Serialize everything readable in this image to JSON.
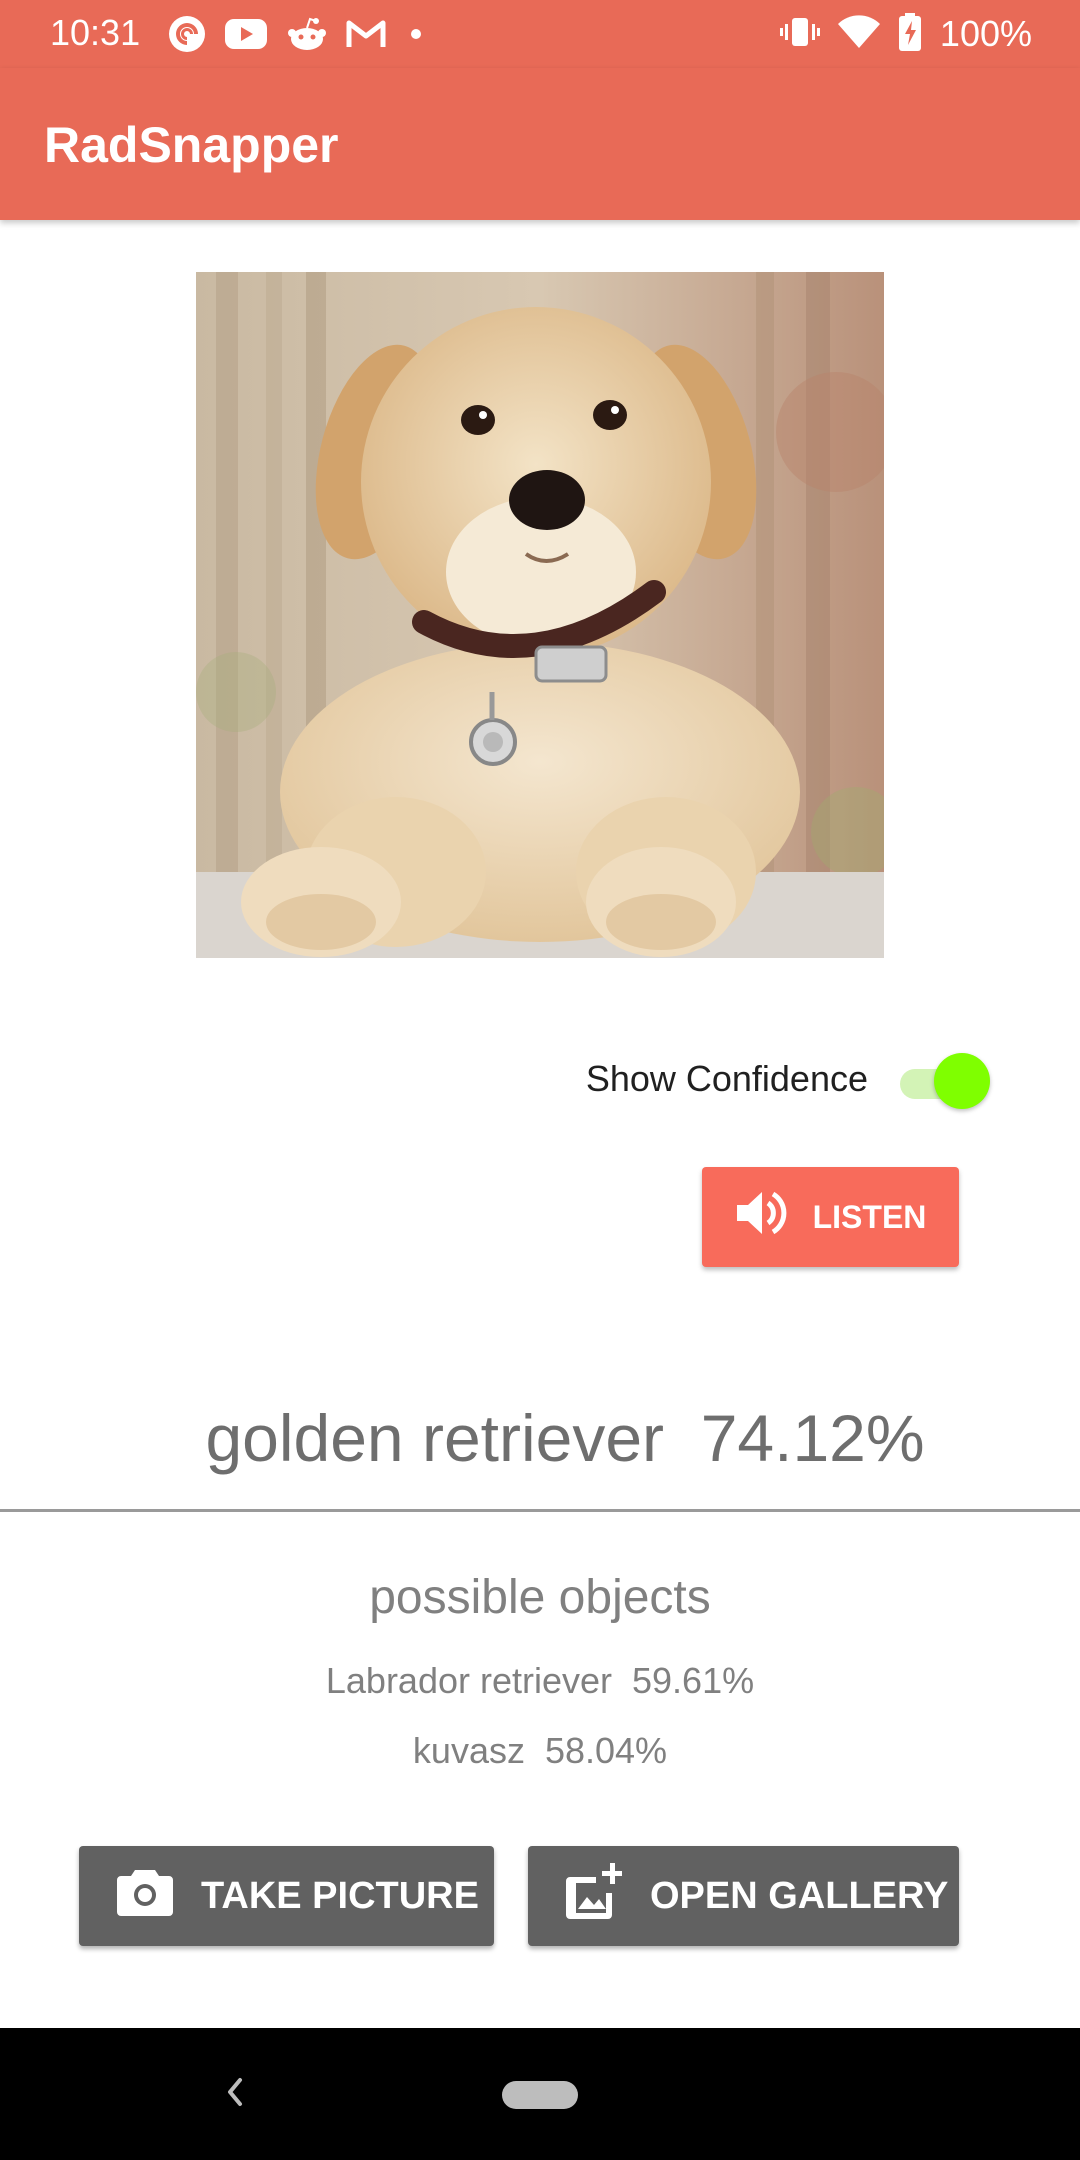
{
  "status_bar": {
    "time": "10:31",
    "notification_icons": [
      "pocket-casts-icon",
      "youtube-icon",
      "reddit-icon",
      "gmail-icon",
      "more-notifications-dot-icon"
    ],
    "system_icons": [
      "vibrate-icon",
      "wifi-icon",
      "battery-charging-icon"
    ],
    "battery": "100%",
    "background_color": "#E86A57"
  },
  "app_bar": {
    "title": "RadSnapper",
    "background_color": "#E86A57"
  },
  "image": {
    "subject": "golden retriever puppy"
  },
  "confidence_toggle": {
    "label": "Show Confidence",
    "checked": true,
    "thumb_color": "#7FFF00"
  },
  "listen_button": {
    "label": "LISTEN",
    "icon": "volume-up-icon",
    "color": "#F86B5B"
  },
  "result": {
    "top_label": "golden retriever  74.12%"
  },
  "possible": {
    "title": "possible objects",
    "items": [
      "Labrador retriever  59.61%",
      "kuvasz  58.04%"
    ]
  },
  "actions": {
    "take_picture": "TAKE PICTURE",
    "take_picture_icon": "camera-icon",
    "open_gallery": "OPEN GALLERY",
    "open_gallery_icon": "add-photo-icon",
    "color": "#616161"
  },
  "nav_bar": {
    "icons": [
      "back-icon",
      "home-pill-icon"
    ]
  }
}
